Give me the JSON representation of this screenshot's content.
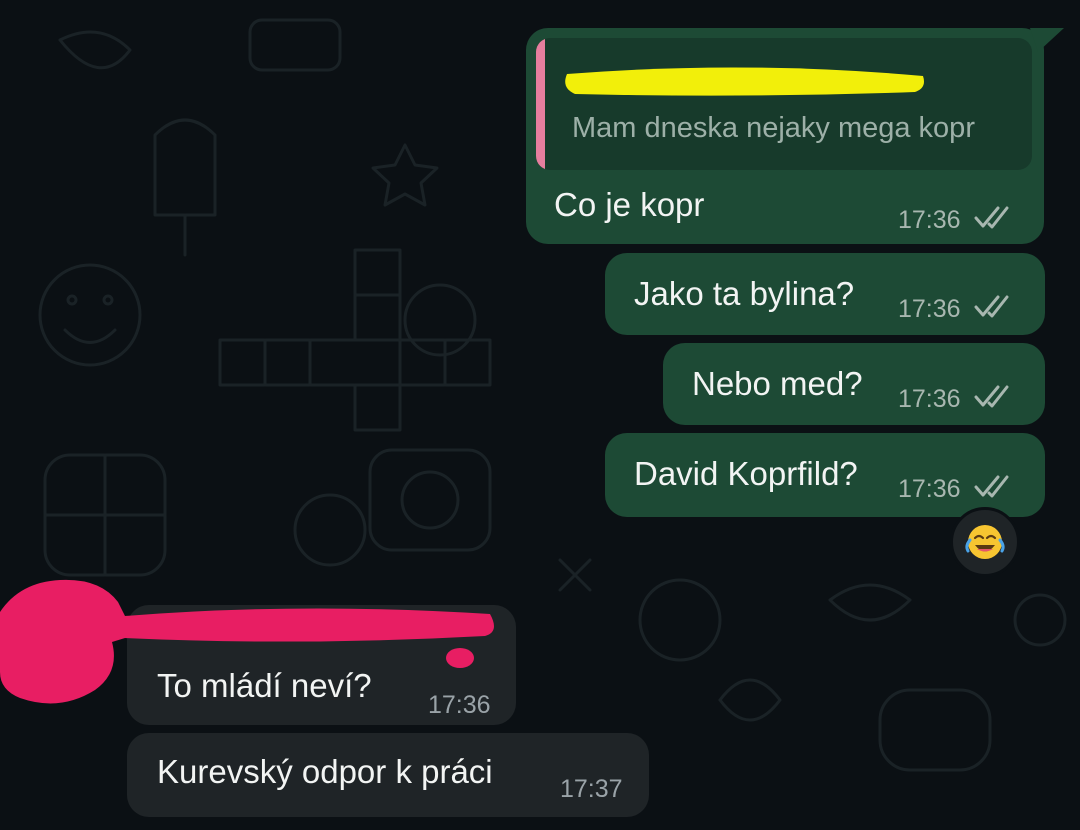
{
  "messages": [
    {
      "direction": "outgoing",
      "quoted": {
        "text": "Mam dneska nejaky mega kopr",
        "sender_redacted": true
      },
      "text": "Co je kopr",
      "time": "17:36",
      "status": "read"
    },
    {
      "direction": "outgoing",
      "text": "Jako ta bylina?",
      "time": "17:36",
      "status": "read"
    },
    {
      "direction": "outgoing",
      "text": "Nebo med?",
      "time": "17:36",
      "status": "read"
    },
    {
      "direction": "outgoing",
      "text": "David Koprfild?",
      "time": "17:36",
      "status": "read",
      "reaction": "face-with-tears-of-joy"
    },
    {
      "direction": "incoming",
      "sender_redacted": true,
      "text": "To mládí neví?",
      "time": "17:36"
    },
    {
      "direction": "incoming",
      "text": "Kurevský odpor k práci",
      "time": "17:37"
    }
  ],
  "colors": {
    "outgoing_bubble": "#1d4a35",
    "incoming_bubble": "#1f2427",
    "read_ticks": "#a8b7b0",
    "quote_accent": "#e67e9e",
    "redaction_yellow": "#f2ef0a",
    "redaction_pink": "#e81e63"
  },
  "icons": [
    "double-check-icon",
    "laughing-emoji-icon"
  ]
}
